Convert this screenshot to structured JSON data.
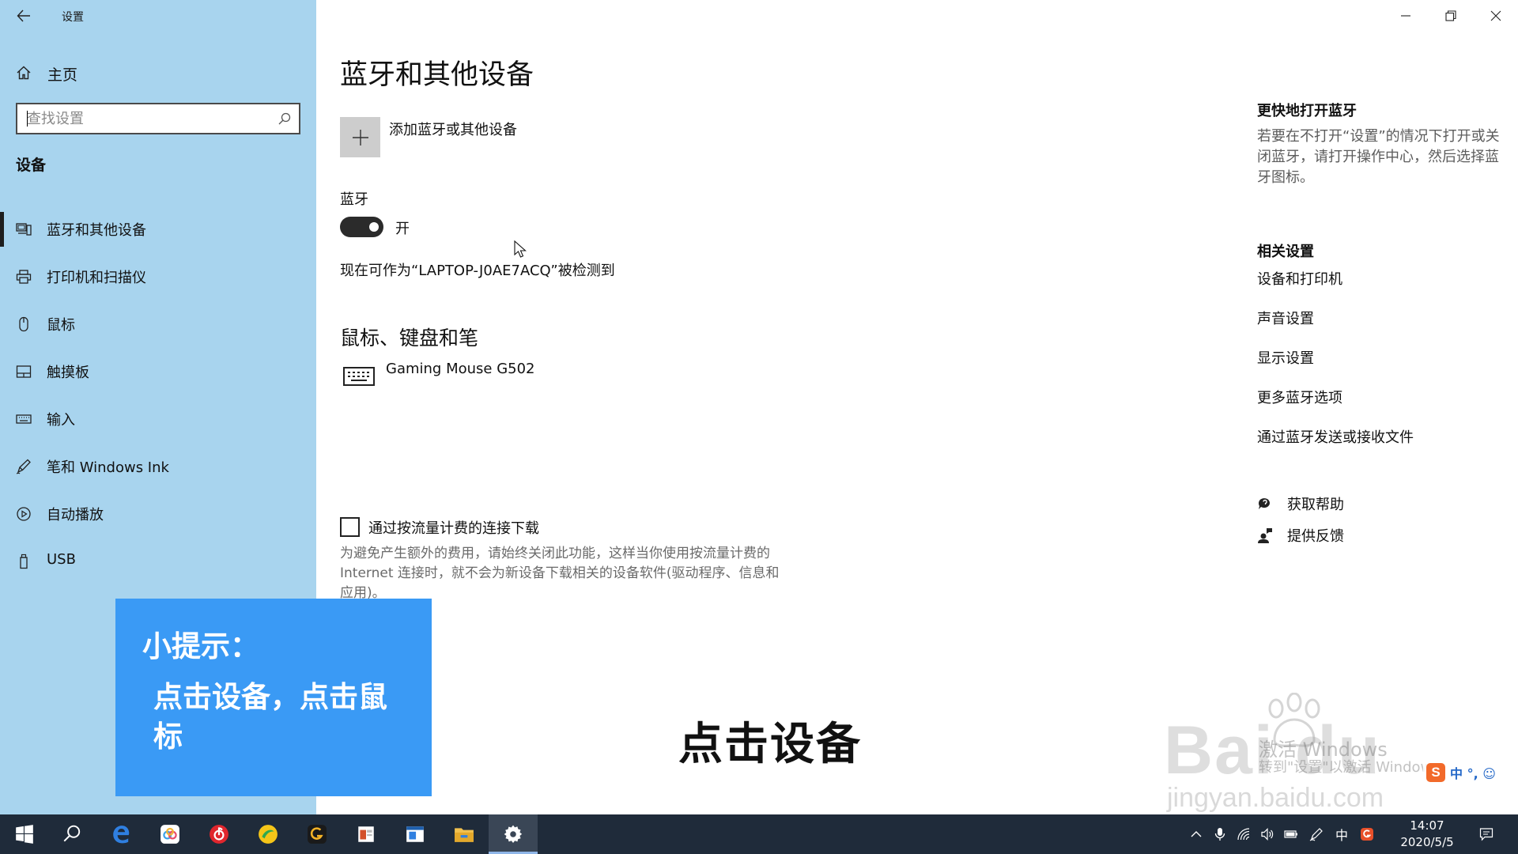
{
  "window": {
    "app_title": "设置"
  },
  "sidebar": {
    "home_label": "主页",
    "search_placeholder": "查找设置",
    "section_title": "设备",
    "items": [
      {
        "label": "蓝牙和其他设备",
        "icon": "bluetooth-devices-icon",
        "selected": true
      },
      {
        "label": "打印机和扫描仪",
        "icon": "printer-icon",
        "selected": false
      },
      {
        "label": "鼠标",
        "icon": "mouse-icon",
        "selected": false
      },
      {
        "label": "触摸板",
        "icon": "touchpad-icon",
        "selected": false
      },
      {
        "label": "输入",
        "icon": "keyboard-icon",
        "selected": false
      },
      {
        "label": "笔和 Windows Ink",
        "icon": "pen-icon",
        "selected": false
      },
      {
        "label": "自动播放",
        "icon": "autoplay-icon",
        "selected": false
      },
      {
        "label": "USB",
        "icon": "usb-icon",
        "selected": false
      }
    ]
  },
  "main": {
    "page_title": "蓝牙和其他设备",
    "add_device_label": "添加蓝牙或其他设备",
    "bluetooth_label": "蓝牙",
    "bluetooth_state": "开",
    "bluetooth_on": true,
    "discoverable_text": "现在可作为“LAPTOP-J0AE7ACQ”被检测到",
    "mouse_section_title": "鼠标、键盘和笔",
    "devices": [
      {
        "name": "Gaming Mouse G502",
        "icon": "keyboard-icon"
      }
    ],
    "metered_label": "通过按流量计费的连接下载",
    "metered_checked": false,
    "metered_desc": "为避免产生额外的费用，请始终关闭此功能，这样当你使用按流量计费的 Internet 连接时，就不会为新设备下载相关的设备软件(驱动程序、信息和应用)。"
  },
  "side_panel": {
    "quick_title": "更快地打开蓝牙",
    "quick_text": "若要在不打开“设置”的情况下打开或关闭蓝牙，请打开操作中心，然后选择蓝牙图标。",
    "related_title": "相关设置",
    "related_links": [
      "设备和打印机",
      "声音设置",
      "显示设置",
      "更多蓝牙选项",
      "通过蓝牙发送或接收文件"
    ],
    "help_label": "获取帮助",
    "feedback_label": "提供反馈"
  },
  "overlay": {
    "tip_title": "小提示：",
    "tip_body": "点击设备，点击鼠标",
    "caption": "点击设备",
    "tip_color": "#3a9af5"
  },
  "watermark": {
    "brand": "Bai du",
    "url": "jingyan.baidu.com",
    "activate_line1": "激活 Windows",
    "activate_line2": "转到\"设置\"以激活 Windows。"
  },
  "ime": {
    "logo": "S",
    "text": "中 °, ☺"
  },
  "taskbar": {
    "apps": [
      "start-icon",
      "search-icon",
      "edge-icon",
      "baidu-netdisk-icon",
      "netease-music-icon",
      "qq-browser-icon",
      "sogou-icon",
      "powerpoint-icon",
      "window-app-icon",
      "file-explorer-icon",
      "settings-icon"
    ],
    "tray_ime": "中",
    "time": "14:07",
    "date": "2020/5/5"
  },
  "colors": {
    "sidebar_bg": "#a8d4ee",
    "taskbar_bg": "#1f2b3a",
    "toggle_on": "#2b2b2b"
  }
}
